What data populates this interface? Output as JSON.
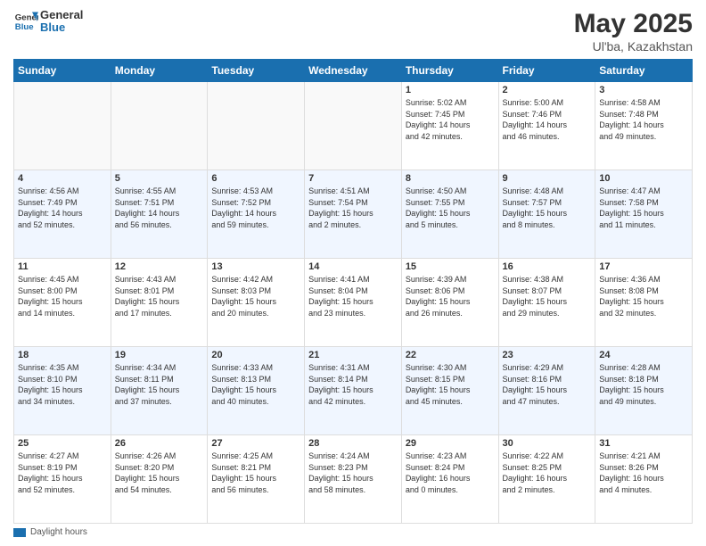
{
  "header": {
    "logo_text_general": "General",
    "logo_text_blue": "Blue",
    "month_year": "May 2025",
    "location": "Ul'ba, Kazakhstan"
  },
  "footer": {
    "label": "Daylight hours"
  },
  "days_of_week": [
    "Sunday",
    "Monday",
    "Tuesday",
    "Wednesday",
    "Thursday",
    "Friday",
    "Saturday"
  ],
  "weeks": [
    [
      {
        "day": "",
        "info": ""
      },
      {
        "day": "",
        "info": ""
      },
      {
        "day": "",
        "info": ""
      },
      {
        "day": "",
        "info": ""
      },
      {
        "day": "1",
        "info": "Sunrise: 5:02 AM\nSunset: 7:45 PM\nDaylight: 14 hours\nand 42 minutes."
      },
      {
        "day": "2",
        "info": "Sunrise: 5:00 AM\nSunset: 7:46 PM\nDaylight: 14 hours\nand 46 minutes."
      },
      {
        "day": "3",
        "info": "Sunrise: 4:58 AM\nSunset: 7:48 PM\nDaylight: 14 hours\nand 49 minutes."
      }
    ],
    [
      {
        "day": "4",
        "info": "Sunrise: 4:56 AM\nSunset: 7:49 PM\nDaylight: 14 hours\nand 52 minutes."
      },
      {
        "day": "5",
        "info": "Sunrise: 4:55 AM\nSunset: 7:51 PM\nDaylight: 14 hours\nand 56 minutes."
      },
      {
        "day": "6",
        "info": "Sunrise: 4:53 AM\nSunset: 7:52 PM\nDaylight: 14 hours\nand 59 minutes."
      },
      {
        "day": "7",
        "info": "Sunrise: 4:51 AM\nSunset: 7:54 PM\nDaylight: 15 hours\nand 2 minutes."
      },
      {
        "day": "8",
        "info": "Sunrise: 4:50 AM\nSunset: 7:55 PM\nDaylight: 15 hours\nand 5 minutes."
      },
      {
        "day": "9",
        "info": "Sunrise: 4:48 AM\nSunset: 7:57 PM\nDaylight: 15 hours\nand 8 minutes."
      },
      {
        "day": "10",
        "info": "Sunrise: 4:47 AM\nSunset: 7:58 PM\nDaylight: 15 hours\nand 11 minutes."
      }
    ],
    [
      {
        "day": "11",
        "info": "Sunrise: 4:45 AM\nSunset: 8:00 PM\nDaylight: 15 hours\nand 14 minutes."
      },
      {
        "day": "12",
        "info": "Sunrise: 4:43 AM\nSunset: 8:01 PM\nDaylight: 15 hours\nand 17 minutes."
      },
      {
        "day": "13",
        "info": "Sunrise: 4:42 AM\nSunset: 8:03 PM\nDaylight: 15 hours\nand 20 minutes."
      },
      {
        "day": "14",
        "info": "Sunrise: 4:41 AM\nSunset: 8:04 PM\nDaylight: 15 hours\nand 23 minutes."
      },
      {
        "day": "15",
        "info": "Sunrise: 4:39 AM\nSunset: 8:06 PM\nDaylight: 15 hours\nand 26 minutes."
      },
      {
        "day": "16",
        "info": "Sunrise: 4:38 AM\nSunset: 8:07 PM\nDaylight: 15 hours\nand 29 minutes."
      },
      {
        "day": "17",
        "info": "Sunrise: 4:36 AM\nSunset: 8:08 PM\nDaylight: 15 hours\nand 32 minutes."
      }
    ],
    [
      {
        "day": "18",
        "info": "Sunrise: 4:35 AM\nSunset: 8:10 PM\nDaylight: 15 hours\nand 34 minutes."
      },
      {
        "day": "19",
        "info": "Sunrise: 4:34 AM\nSunset: 8:11 PM\nDaylight: 15 hours\nand 37 minutes."
      },
      {
        "day": "20",
        "info": "Sunrise: 4:33 AM\nSunset: 8:13 PM\nDaylight: 15 hours\nand 40 minutes."
      },
      {
        "day": "21",
        "info": "Sunrise: 4:31 AM\nSunset: 8:14 PM\nDaylight: 15 hours\nand 42 minutes."
      },
      {
        "day": "22",
        "info": "Sunrise: 4:30 AM\nSunset: 8:15 PM\nDaylight: 15 hours\nand 45 minutes."
      },
      {
        "day": "23",
        "info": "Sunrise: 4:29 AM\nSunset: 8:16 PM\nDaylight: 15 hours\nand 47 minutes."
      },
      {
        "day": "24",
        "info": "Sunrise: 4:28 AM\nSunset: 8:18 PM\nDaylight: 15 hours\nand 49 minutes."
      }
    ],
    [
      {
        "day": "25",
        "info": "Sunrise: 4:27 AM\nSunset: 8:19 PM\nDaylight: 15 hours\nand 52 minutes."
      },
      {
        "day": "26",
        "info": "Sunrise: 4:26 AM\nSunset: 8:20 PM\nDaylight: 15 hours\nand 54 minutes."
      },
      {
        "day": "27",
        "info": "Sunrise: 4:25 AM\nSunset: 8:21 PM\nDaylight: 15 hours\nand 56 minutes."
      },
      {
        "day": "28",
        "info": "Sunrise: 4:24 AM\nSunset: 8:23 PM\nDaylight: 15 hours\nand 58 minutes."
      },
      {
        "day": "29",
        "info": "Sunrise: 4:23 AM\nSunset: 8:24 PM\nDaylight: 16 hours\nand 0 minutes."
      },
      {
        "day": "30",
        "info": "Sunrise: 4:22 AM\nSunset: 8:25 PM\nDaylight: 16 hours\nand 2 minutes."
      },
      {
        "day": "31",
        "info": "Sunrise: 4:21 AM\nSunset: 8:26 PM\nDaylight: 16 hours\nand 4 minutes."
      }
    ]
  ]
}
